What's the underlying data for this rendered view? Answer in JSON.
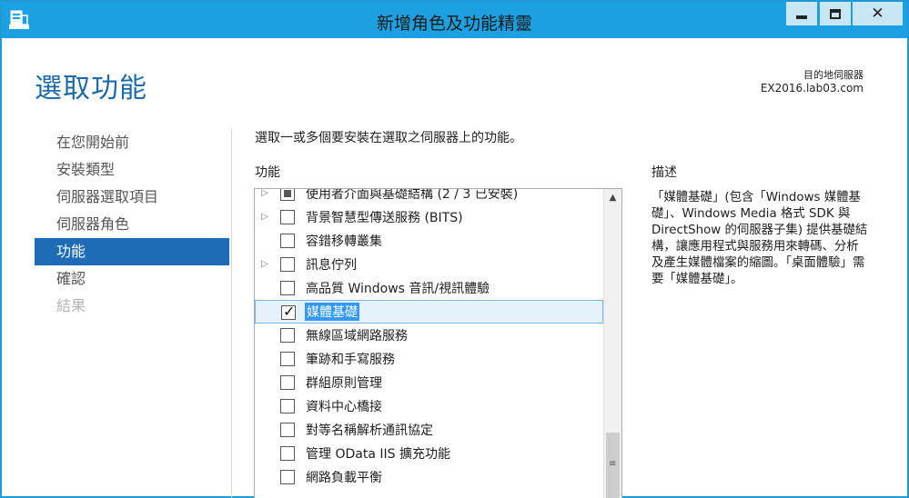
{
  "window": {
    "title": "新增角色及功能精靈"
  },
  "header": {
    "page_title": "選取功能",
    "destination_label": "目的地伺服器",
    "destination_server": "EX2016.lab03.com"
  },
  "nav": {
    "items": [
      {
        "label": "在您開始前",
        "state": "normal"
      },
      {
        "label": "安裝類型",
        "state": "normal"
      },
      {
        "label": "伺服器選取項目",
        "state": "normal"
      },
      {
        "label": "伺服器角色",
        "state": "normal"
      },
      {
        "label": "功能",
        "state": "active"
      },
      {
        "label": "確認",
        "state": "normal"
      },
      {
        "label": "結果",
        "state": "disabled"
      }
    ]
  },
  "main": {
    "instruction": "選取一或多個要安裝在選取之伺服器上的功能。",
    "features_heading": "功能",
    "description_heading": "描述",
    "features": [
      {
        "label": "使用者介面與基礎結構 (2 / 3 已安裝)",
        "expandable": true,
        "checked": "partial"
      },
      {
        "label": "背景智慧型傳送服務 (BITS)",
        "expandable": true,
        "checked": false
      },
      {
        "label": "容錯移轉叢集",
        "expandable": false,
        "checked": false
      },
      {
        "label": "訊息佇列",
        "expandable": true,
        "checked": false
      },
      {
        "label": "高品質 Windows 音訊/視訊體驗",
        "expandable": false,
        "checked": false
      },
      {
        "label": "媒體基礎",
        "expandable": false,
        "checked": true,
        "selected": true
      },
      {
        "label": "無線區域網路服務",
        "expandable": false,
        "checked": false
      },
      {
        "label": "筆跡和手寫服務",
        "expandable": false,
        "checked": false
      },
      {
        "label": "群組原則管理",
        "expandable": false,
        "checked": false
      },
      {
        "label": "資料中心橋接",
        "expandable": false,
        "checked": false
      },
      {
        "label": "對等名稱解析通訊協定",
        "expandable": false,
        "checked": false
      },
      {
        "label": "管理 OData IIS 擴充功能",
        "expandable": false,
        "checked": false
      },
      {
        "label": "網路負載平衡",
        "expandable": false,
        "checked": false
      }
    ],
    "description": "「媒體基礎」(包含「Windows 媒體基礎」、Windows Media 格式 SDK 與 DirectShow 的伺服器子集) 提供基礎結構，讓應用程式與服務用來轉碼、分析及產生媒體檔案的縮圖。「桌面體驗」需要「媒體基礎」。"
  },
  "icons": {
    "app": "server-manager-icon",
    "expander": "triangle-right-icon",
    "checkmark": "✓",
    "scroll_up": "▲",
    "scroll_grip": "≡"
  },
  "colors": {
    "titlebar": "#1ba1e2",
    "nav_active": "#1e6cb5",
    "page_title": "#1e6aa6",
    "selection": "#3399ff"
  }
}
